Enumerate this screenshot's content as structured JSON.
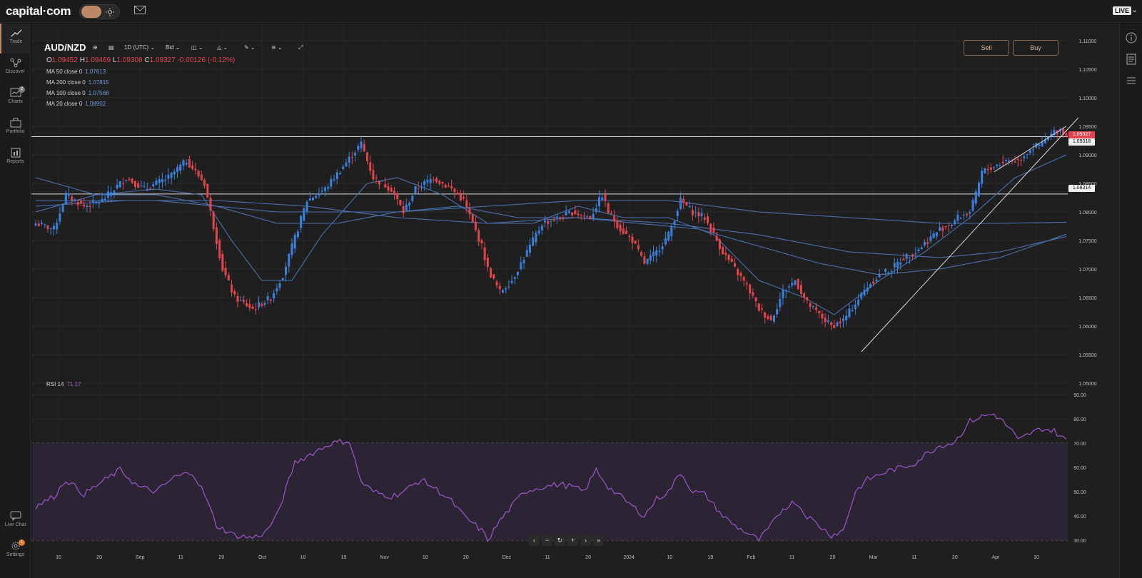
{
  "header": {
    "logo": "capital·com",
    "live_badge": "LIVE"
  },
  "sidebar": {
    "items": [
      {
        "label": "Trade",
        "icon": "trend-chart-icon"
      },
      {
        "label": "Discover",
        "icon": "network-icon"
      },
      {
        "label": "Charts",
        "icon": "charts-icon",
        "badge": "2"
      },
      {
        "label": "Portfolio",
        "icon": "briefcase-icon"
      },
      {
        "label": "Reports",
        "icon": "report-icon"
      }
    ],
    "bottom": [
      {
        "label": "Live Chat",
        "icon": "chat-icon"
      },
      {
        "label": "Settings",
        "icon": "gear-icon",
        "badge": "1"
      }
    ]
  },
  "chart_toolbar": {
    "symbol": "AUD/NZD",
    "timeframe": "1D (UTC)",
    "price_type": "Bid"
  },
  "ohlc": {
    "o_label": "O",
    "o": "1.09452",
    "h_label": "H",
    "h": "1.09469",
    "l_label": "L",
    "l": "1.09308",
    "c_label": "C",
    "c": "1.09327",
    "change": "-0.00126 (-0.12%)"
  },
  "indicators": [
    {
      "label": "MA 50 close 0",
      "value": "1.07613"
    },
    {
      "label": "MA 200 close 0",
      "value": "1.07815"
    },
    {
      "label": "MA 100 close 0",
      "value": "1.07568"
    },
    {
      "label": "MA 20 close 0",
      "value": "1.08902"
    }
  ],
  "rsi": {
    "label": "RSI 14",
    "value": "71.17"
  },
  "trade": {
    "sell": "Sell",
    "buy": "Buy"
  },
  "price_labels": {
    "current": "1.09327",
    "line1": "1.09318",
    "line2": "1.08314"
  },
  "colors": {
    "up": "#3a7fd9",
    "down": "#e0454e",
    "ma": "#4b6ea8",
    "rsi": "#9b55c9",
    "accent": "#b9896a"
  },
  "chart_data": {
    "type": "candlestick",
    "price_axis": [
      "1.11000",
      "1.10500",
      "1.10000",
      "1.09500",
      "1.09000",
      "1.08500",
      "1.08000",
      "1.07500",
      "1.07000",
      "1.06500",
      "1.06000",
      "1.05500",
      "1.05000"
    ],
    "rsi_axis": [
      "90.00",
      "80.00",
      "70.00",
      "60.00",
      "50.00",
      "40.00",
      "30.00"
    ],
    "date_axis": [
      "10",
      "20",
      "Sep",
      "11",
      "20",
      "Oct",
      "10",
      "19",
      "Nov",
      "10",
      "20",
      "Dec",
      "11",
      "20",
      "2024",
      "10",
      "19",
      "Feb",
      "11",
      "20",
      "Mar",
      "11",
      "20",
      "Apr",
      "10"
    ],
    "ylim": [
      1.05,
      1.11
    ],
    "rsi_ylim": [
      30,
      90
    ],
    "horizontal_lines": [
      1.09318,
      1.08314
    ],
    "anchors": [
      [
        0,
        1.078
      ],
      [
        6,
        1.077
      ],
      [
        10,
        1.083
      ],
      [
        16,
        1.081
      ],
      [
        22,
        1.082
      ],
      [
        30,
        1.086
      ],
      [
        36,
        1.084
      ],
      [
        44,
        1.086
      ],
      [
        50,
        1.089
      ],
      [
        56,
        1.085
      ],
      [
        62,
        1.07
      ],
      [
        66,
        1.065
      ],
      [
        72,
        1.063
      ],
      [
        78,
        1.065
      ],
      [
        82,
        1.069
      ],
      [
        90,
        1.082
      ],
      [
        96,
        1.084
      ],
      [
        102,
        1.088
      ],
      [
        108,
        1.092
      ],
      [
        112,
        1.086
      ],
      [
        118,
        1.084
      ],
      [
        122,
        1.08
      ],
      [
        126,
        1.084
      ],
      [
        132,
        1.086
      ],
      [
        138,
        1.084
      ],
      [
        142,
        1.082
      ],
      [
        148,
        1.074
      ],
      [
        150,
        1.07
      ],
      [
        154,
        1.066
      ],
      [
        158,
        1.068
      ],
      [
        162,
        1.072
      ],
      [
        168,
        1.078
      ],
      [
        174,
        1.079
      ],
      [
        178,
        1.08
      ],
      [
        184,
        1.079
      ],
      [
        188,
        1.083
      ],
      [
        190,
        1.08
      ],
      [
        194,
        1.077
      ],
      [
        198,
        1.075
      ],
      [
        202,
        1.071
      ],
      [
        206,
        1.073
      ],
      [
        210,
        1.076
      ],
      [
        214,
        1.082
      ],
      [
        218,
        1.08
      ],
      [
        222,
        1.079
      ],
      [
        228,
        1.073
      ],
      [
        232,
        1.07
      ],
      [
        236,
        1.067
      ],
      [
        240,
        1.063
      ],
      [
        244,
        1.061
      ],
      [
        248,
        1.066
      ],
      [
        252,
        1.068
      ],
      [
        256,
        1.064
      ],
      [
        260,
        1.062
      ],
      [
        264,
        1.06
      ],
      [
        268,
        1.061
      ],
      [
        272,
        1.064
      ],
      [
        276,
        1.067
      ],
      [
        280,
        1.069
      ],
      [
        284,
        1.07
      ],
      [
        288,
        1.072
      ],
      [
        292,
        1.073
      ],
      [
        296,
        1.075
      ],
      [
        300,
        1.077
      ],
      [
        304,
        1.078
      ],
      [
        306,
        1.079
      ],
      [
        310,
        1.08
      ],
      [
        312,
        1.083
      ],
      [
        314,
        1.087
      ],
      [
        318,
        1.088
      ],
      [
        322,
        1.089
      ],
      [
        326,
        1.089
      ],
      [
        330,
        1.091
      ],
      [
        334,
        1.092
      ],
      [
        338,
        1.094
      ],
      [
        340,
        1.0945
      ],
      [
        342,
        1.0933
      ]
    ],
    "rsi_anchors": [
      [
        0,
        44
      ],
      [
        6,
        48
      ],
      [
        10,
        55
      ],
      [
        16,
        49
      ],
      [
        22,
        54
      ],
      [
        28,
        59
      ],
      [
        34,
        52
      ],
      [
        40,
        50
      ],
      [
        46,
        56
      ],
      [
        52,
        58
      ],
      [
        56,
        49
      ],
      [
        60,
        36
      ],
      [
        66,
        32
      ],
      [
        72,
        31
      ],
      [
        76,
        33
      ],
      [
        80,
        40
      ],
      [
        86,
        62
      ],
      [
        92,
        66
      ],
      [
        98,
        70
      ],
      [
        104,
        71
      ],
      [
        108,
        54
      ],
      [
        112,
        50
      ],
      [
        118,
        48
      ],
      [
        122,
        50
      ],
      [
        128,
        55
      ],
      [
        134,
        50
      ],
      [
        138,
        46
      ],
      [
        142,
        40
      ],
      [
        148,
        34
      ],
      [
        150,
        30
      ],
      [
        154,
        38
      ],
      [
        158,
        44
      ],
      [
        162,
        50
      ],
      [
        168,
        52
      ],
      [
        174,
        53
      ],
      [
        178,
        52
      ],
      [
        182,
        50
      ],
      [
        186,
        59
      ],
      [
        190,
        52
      ],
      [
        194,
        48
      ],
      [
        198,
        44
      ],
      [
        202,
        40
      ],
      [
        206,
        47
      ],
      [
        210,
        50
      ],
      [
        214,
        58
      ],
      [
        218,
        50
      ],
      [
        222,
        49
      ],
      [
        228,
        40
      ],
      [
        232,
        36
      ],
      [
        236,
        33
      ],
      [
        240,
        30
      ],
      [
        244,
        36
      ],
      [
        248,
        43
      ],
      [
        252,
        46
      ],
      [
        256,
        40
      ],
      [
        260,
        36
      ],
      [
        264,
        32
      ],
      [
        268,
        34
      ],
      [
        272,
        50
      ],
      [
        276,
        55
      ],
      [
        280,
        57
      ],
      [
        284,
        59
      ],
      [
        288,
        60
      ],
      [
        292,
        62
      ],
      [
        296,
        66
      ],
      [
        300,
        69
      ],
      [
        304,
        70
      ],
      [
        306,
        72
      ],
      [
        310,
        79
      ],
      [
        314,
        81
      ],
      [
        318,
        82
      ],
      [
        320,
        80
      ],
      [
        324,
        75
      ],
      [
        326,
        71
      ],
      [
        330,
        74
      ],
      [
        334,
        76
      ],
      [
        338,
        75
      ],
      [
        342,
        71
      ]
    ],
    "ma_series": [
      {
        "name": "MA 20 close 0",
        "anchors": [
          [
            0,
            1.08
          ],
          [
            20,
            1.083
          ],
          [
            40,
            1.084
          ],
          [
            55,
            1.083
          ],
          [
            65,
            1.075
          ],
          [
            75,
            1.068
          ],
          [
            85,
            1.068
          ],
          [
            95,
            1.076
          ],
          [
            110,
            1.085
          ],
          [
            120,
            1.086
          ],
          [
            135,
            1.083
          ],
          [
            150,
            1.078
          ],
          [
            165,
            1.078
          ],
          [
            180,
            1.081
          ],
          [
            195,
            1.079
          ],
          [
            210,
            1.079
          ],
          [
            225,
            1.076
          ],
          [
            240,
            1.068
          ],
          [
            255,
            1.065
          ],
          [
            265,
            1.062
          ],
          [
            280,
            1.068
          ],
          [
            295,
            1.073
          ],
          [
            310,
            1.079
          ],
          [
            325,
            1.086
          ],
          [
            342,
            1.09
          ]
        ]
      },
      {
        "name": "MA 50 close 0",
        "anchors": [
          [
            0,
            1.086
          ],
          [
            20,
            1.083
          ],
          [
            40,
            1.083
          ],
          [
            60,
            1.081
          ],
          [
            80,
            1.078
          ],
          [
            100,
            1.078
          ],
          [
            120,
            1.08
          ],
          [
            140,
            1.081
          ],
          [
            160,
            1.079
          ],
          [
            180,
            1.079
          ],
          [
            200,
            1.078
          ],
          [
            220,
            1.077
          ],
          [
            240,
            1.074
          ],
          [
            260,
            1.071
          ],
          [
            280,
            1.069
          ],
          [
            300,
            1.07
          ],
          [
            320,
            1.072
          ],
          [
            342,
            1.0761
          ]
        ]
      },
      {
        "name": "MA 100 close 0",
        "anchors": [
          [
            0,
            1.081
          ],
          [
            30,
            1.082
          ],
          [
            60,
            1.082
          ],
          [
            90,
            1.081
          ],
          [
            120,
            1.079
          ],
          [
            150,
            1.078
          ],
          [
            180,
            1.079
          ],
          [
            210,
            1.078
          ],
          [
            240,
            1.076
          ],
          [
            270,
            1.073
          ],
          [
            300,
            1.072
          ],
          [
            320,
            1.073
          ],
          [
            342,
            1.0757
          ]
        ]
      },
      {
        "name": "MA 200 close 0",
        "anchors": [
          [
            0,
            1.082
          ],
          [
            40,
            1.082
          ],
          [
            80,
            1.08
          ],
          [
            120,
            1.08
          ],
          [
            150,
            1.081
          ],
          [
            180,
            1.082
          ],
          [
            210,
            1.082
          ],
          [
            240,
            1.08
          ],
          [
            270,
            1.079
          ],
          [
            300,
            1.078
          ],
          [
            320,
            1.078
          ],
          [
            342,
            1.0782
          ]
        ]
      }
    ],
    "trend_lines": [
      {
        "from": [
          274,
          1.0555
        ],
        "to": [
          346,
          1.0965
        ]
      },
      {
        "from": [
          318,
          1.087
        ],
        "to": [
          342,
          1.095
        ]
      }
    ]
  }
}
